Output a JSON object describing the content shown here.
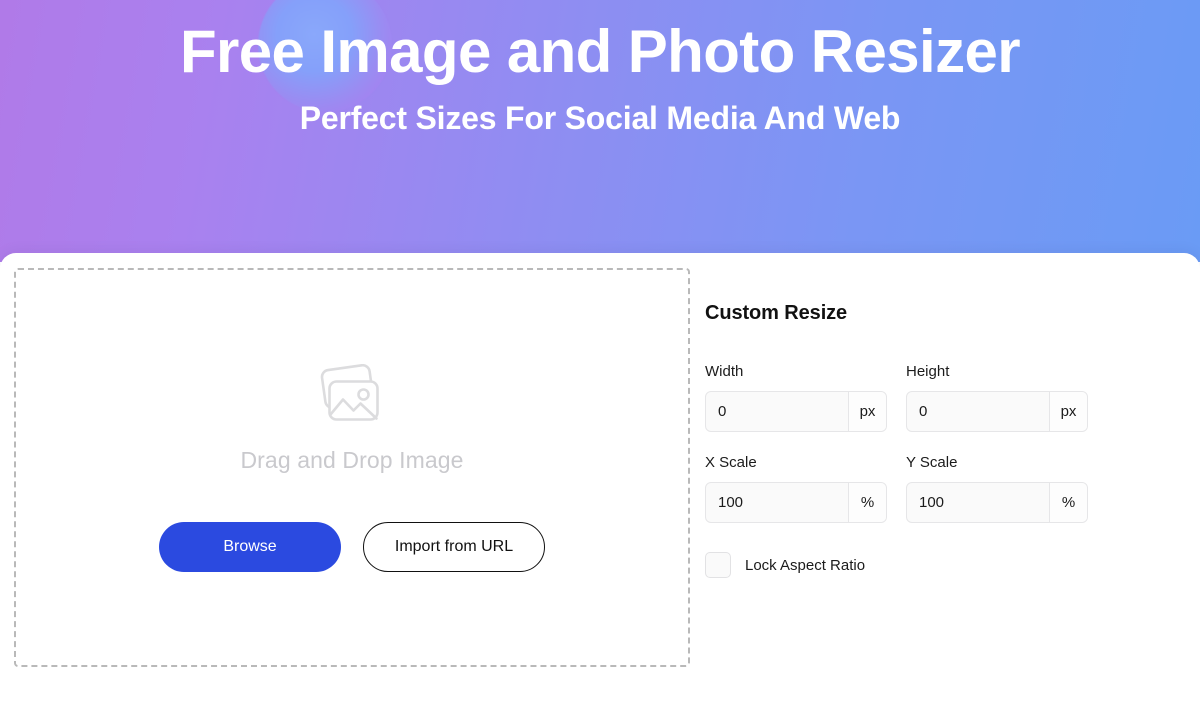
{
  "hero": {
    "title": "Free Image and Photo Resizer",
    "subtitle": "Perfect Sizes For Social Media And Web",
    "gradient_start": "#b07ae8",
    "gradient_end": "#6a9bf5",
    "blob_color": "#85a0fa"
  },
  "dropzone": {
    "icon": "image-placeholder-icon",
    "text": "Drag and Drop Image",
    "browse_label": "Browse",
    "import_label": "Import from URL",
    "browse_color": "#2b4ae0",
    "border_color": "#b9b9b9"
  },
  "panel": {
    "title": "Custom Resize",
    "fields": [
      {
        "label": "Width",
        "value": "0",
        "unit": "px",
        "placeholder": "0"
      },
      {
        "label": "Height",
        "value": "0",
        "unit": "px",
        "placeholder": "0"
      },
      {
        "label": "X Scale",
        "value": "100",
        "unit": "%",
        "placeholder": "100"
      },
      {
        "label": "Y Scale",
        "value": "100",
        "unit": "%",
        "placeholder": "100"
      }
    ],
    "lock_aspect_ratio": {
      "label": "Lock Aspect Ratio",
      "checked": false
    }
  }
}
